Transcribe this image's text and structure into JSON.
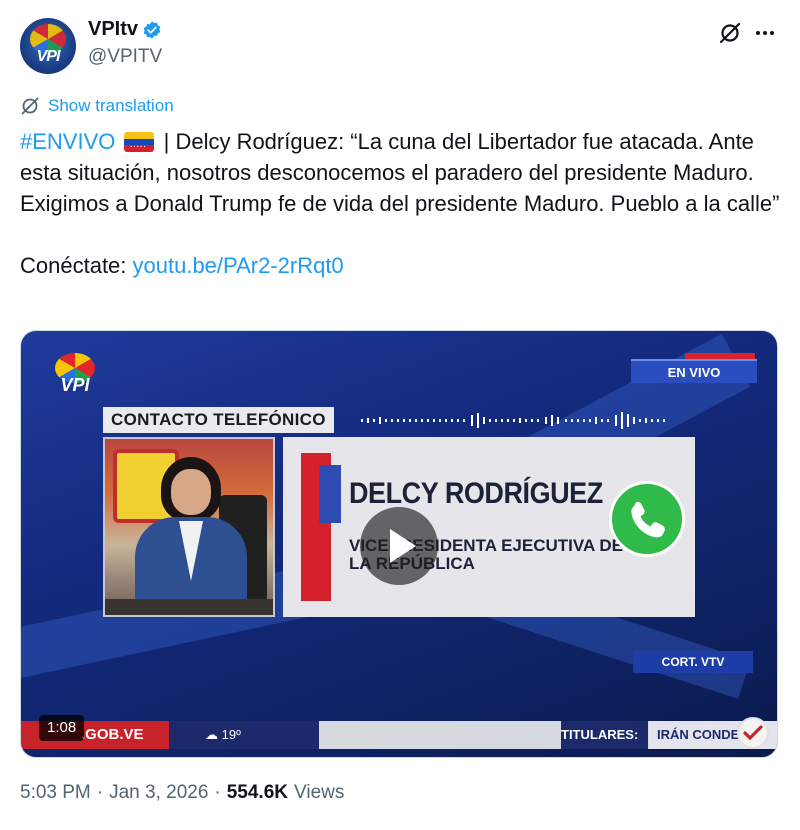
{
  "author": {
    "display_name": "VPItv",
    "handle": "@VPITV",
    "avatar_text": "VPI",
    "verified": true
  },
  "actions": {
    "grok_icon": "grok-slash-icon",
    "more_icon": "more-icon"
  },
  "translate": {
    "label": "Show translation"
  },
  "tweet": {
    "hashtag": "#ENVIVO",
    "text_line1_rest": " | Delcy Rodríguez: “La cuna del Libertador fue atacada. Ante esta situación, nosotros desconocemos el paradero del presidente Maduro. Exigimos a Donald Trump fe de vida del presidente Maduro. Pueblo a la calle”",
    "connect_label": "Conéctate: ",
    "link": "youtu.be/PAr2-2rRqt0"
  },
  "video": {
    "logo_text": "VPI",
    "live_label": "EN VIVO",
    "contact_label": "CONTACTO TELEFÓNICO",
    "person_name": "DELCY RODRÍGUEZ",
    "person_title": "VICEPRESIDENTA EJECUTIVA DE LA REPÚBLICA",
    "credit": "CORT. VTV",
    "ticker_site": ".GOB.VE",
    "ticker_weather": "19º",
    "ticker_headlines_label": "TITULARES:",
    "ticker_headline": "IRÁN CONDENA",
    "duration": "1:08"
  },
  "meta": {
    "time": "5:03 PM",
    "separator": "·",
    "date": "Jan 3, 2026",
    "views_count": "554.6K",
    "views_label": "Views"
  },
  "colors": {
    "link": "#1d9bf0",
    "text": "#0f1419",
    "secondary": "#536471"
  }
}
